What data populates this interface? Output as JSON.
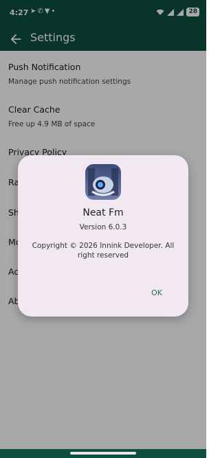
{
  "status_bar": {
    "time": "4:27",
    "left_icons": [
      "telegram-icon",
      "whatsapp-icon",
      "v-shield-icon",
      "notification-dot-icon"
    ],
    "right_icons": [
      "wifi-icon",
      "signal-icon",
      "signal-icon"
    ],
    "battery": "28"
  },
  "app_bar": {
    "title": "Settings",
    "back_icon": "arrow-left-icon"
  },
  "settings": {
    "items": [
      {
        "title": "Push Notification",
        "subtitle": "Manage push notification settings"
      },
      {
        "title": "Clear Cache",
        "subtitle": "Free up 4.9 MB of space"
      },
      {
        "title": "Privacy Policy"
      },
      {
        "title": "Ra"
      },
      {
        "title": "Sh"
      },
      {
        "title": "Mo"
      },
      {
        "title": "Ac"
      },
      {
        "title": "Ab"
      }
    ]
  },
  "dialog": {
    "app_name": "Neat Fm",
    "version": "Version 6.0.3",
    "copyright": "Copyright © 2026 Innink Developer. All right reserved",
    "ok_label": "OK"
  },
  "colors": {
    "primary": "#0f4f3f",
    "dialog_bg": "#f1e8f2",
    "accent_text": "#1f6b5a"
  }
}
